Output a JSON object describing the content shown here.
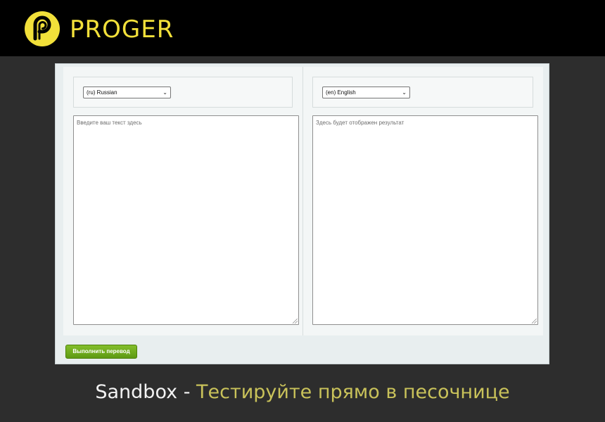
{
  "header": {
    "brand": "PROGER",
    "logo_icon": "proger-logo-icon",
    "brand_color": "#f2e03a"
  },
  "translator": {
    "source": {
      "language": "(ru) Russian",
      "placeholder": "Введите ваш текст здесь"
    },
    "target": {
      "language": "(en) English",
      "placeholder": "Здесь будет отображен результат"
    },
    "submit_label": "Выполнить перевод",
    "submit_color": "#6fac1d"
  },
  "caption": {
    "prefix": "Sandbox - ",
    "highlight": "Тестируйте прямо в песочнице",
    "highlight_color": "#c9c25a"
  }
}
